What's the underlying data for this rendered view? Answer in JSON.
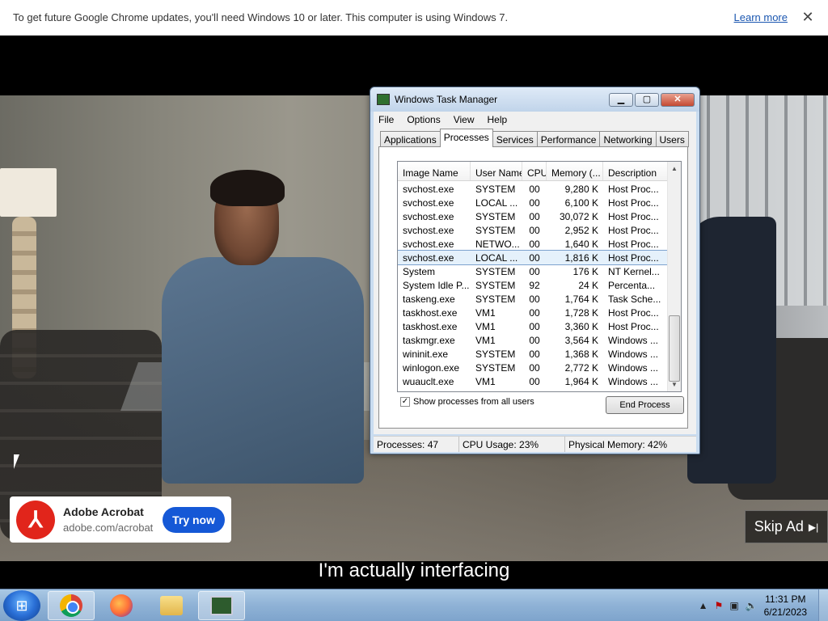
{
  "infobar": {
    "message": "To get future Google Chrome updates, you'll need Windows 10 or later. This computer is using Windows 7.",
    "learn_more": "Learn more",
    "close_glyph": "✕"
  },
  "ad": {
    "logo_glyph": "⅄",
    "title": "Adobe Acrobat",
    "url": "adobe.com/acrobat",
    "cta": "Try now"
  },
  "skip_ad": "Skip Ad",
  "skip_glyph": "▶|",
  "subtitle": "I'm actually interfacing",
  "task_manager": {
    "title": "Windows Task Manager",
    "window_buttons": {
      "minimize": "▁",
      "maximize": "▢",
      "close": "✕"
    },
    "menu": [
      "File",
      "Options",
      "View",
      "Help"
    ],
    "tabs": [
      "Applications",
      "Processes",
      "Services",
      "Performance",
      "Networking",
      "Users"
    ],
    "active_tab": "Processes",
    "columns": [
      "Image Name",
      "User Name",
      "CPU",
      "Memory (...",
      "Description"
    ],
    "rows": [
      {
        "name": "svchost.exe",
        "user": "SYSTEM",
        "cpu": "00",
        "mem": "9,280 K",
        "desc": "Host Proc..."
      },
      {
        "name": "svchost.exe",
        "user": "LOCAL ...",
        "cpu": "00",
        "mem": "6,100 K",
        "desc": "Host Proc..."
      },
      {
        "name": "svchost.exe",
        "user": "SYSTEM",
        "cpu": "00",
        "mem": "30,072 K",
        "desc": "Host Proc..."
      },
      {
        "name": "svchost.exe",
        "user": "SYSTEM",
        "cpu": "00",
        "mem": "2,952 K",
        "desc": "Host Proc..."
      },
      {
        "name": "svchost.exe",
        "user": "NETWO...",
        "cpu": "00",
        "mem": "1,640 K",
        "desc": "Host Proc..."
      },
      {
        "name": "svchost.exe",
        "user": "LOCAL ...",
        "cpu": "00",
        "mem": "1,816 K",
        "desc": "Host Proc...",
        "selected": true
      },
      {
        "name": "System",
        "user": "SYSTEM",
        "cpu": "00",
        "mem": "176 K",
        "desc": "NT Kernel..."
      },
      {
        "name": "System Idle P...",
        "user": "SYSTEM",
        "cpu": "92",
        "mem": "24 K",
        "desc": "Percenta..."
      },
      {
        "name": "taskeng.exe",
        "user": "SYSTEM",
        "cpu": "00",
        "mem": "1,764 K",
        "desc": "Task Sche..."
      },
      {
        "name": "taskhost.exe",
        "user": "VM1",
        "cpu": "00",
        "mem": "1,728 K",
        "desc": "Host Proc..."
      },
      {
        "name": "taskhost.exe",
        "user": "VM1",
        "cpu": "00",
        "mem": "3,360 K",
        "desc": "Host Proc..."
      },
      {
        "name": "taskmgr.exe",
        "user": "VM1",
        "cpu": "00",
        "mem": "3,564 K",
        "desc": "Windows ..."
      },
      {
        "name": "wininit.exe",
        "user": "SYSTEM",
        "cpu": "00",
        "mem": "1,368 K",
        "desc": "Windows ..."
      },
      {
        "name": "winlogon.exe",
        "user": "SYSTEM",
        "cpu": "00",
        "mem": "2,772 K",
        "desc": "Windows ..."
      },
      {
        "name": "wuauclt.exe",
        "user": "VM1",
        "cpu": "00",
        "mem": "1,964 K",
        "desc": "Windows ..."
      }
    ],
    "show_all_label": "Show processes from all users",
    "show_all_checked": true,
    "end_process": "End Process",
    "status": {
      "processes": "Processes: 47",
      "cpu": "CPU Usage: 23%",
      "memory": "Physical Memory: 42%"
    }
  },
  "taskbar": {
    "start_glyph": "⊞",
    "tray_arrow": "▲",
    "tray_flag": "⚑",
    "tray_network": "▣",
    "tray_sound": "🔈",
    "time": "11:31 PM",
    "date": "6/21/2023"
  }
}
